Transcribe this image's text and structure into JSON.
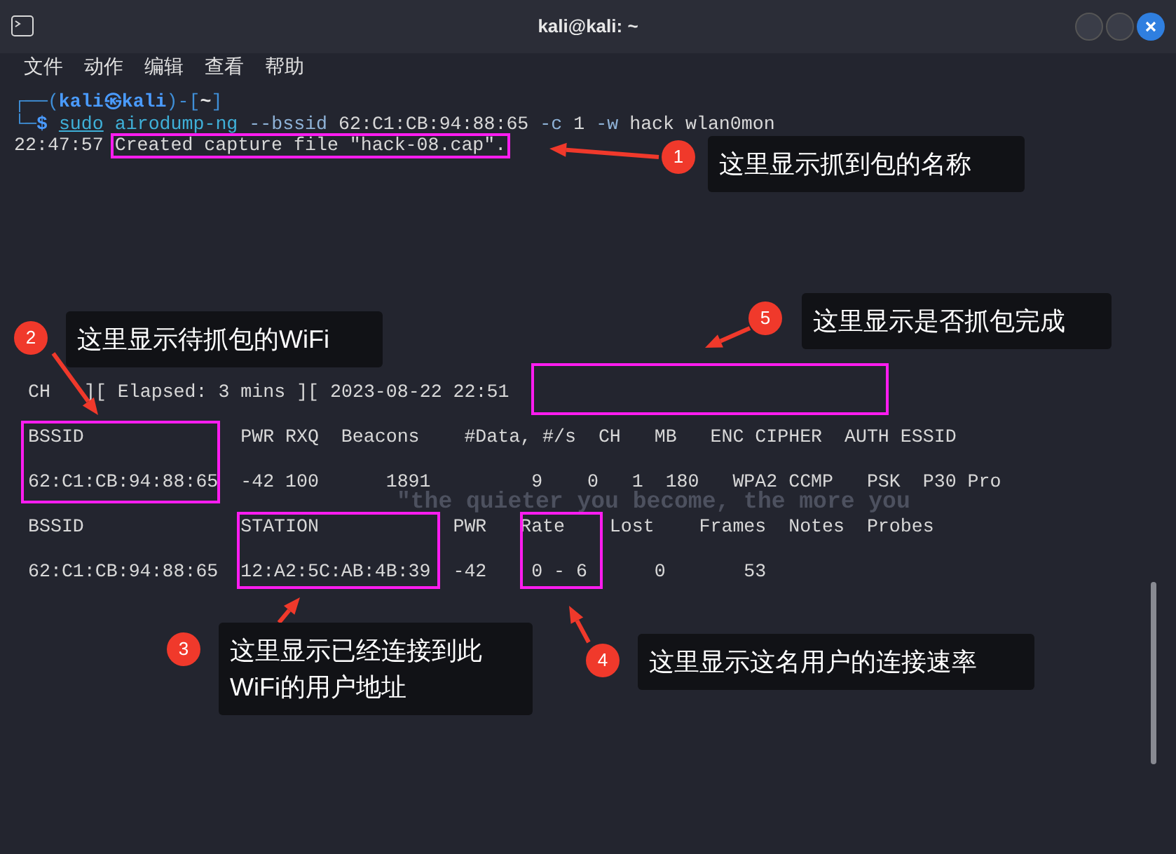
{
  "window": {
    "title": "kali@kali: ~"
  },
  "menu": [
    "文件",
    "动作",
    "编辑",
    "查看",
    "帮助"
  ],
  "terminal": {
    "prompt": [
      {
        "kind": "frame",
        "text": "┌──("
      },
      {
        "kind": "user",
        "text": "kali㉿kali"
      },
      {
        "kind": "frame",
        "text": ")-["
      },
      {
        "kind": "path",
        "text": "~"
      },
      {
        "kind": "frame",
        "text": "]"
      }
    ],
    "command": [
      {
        "kind": "frame",
        "text": "└─"
      },
      {
        "kind": "dollar",
        "text": "$"
      },
      {
        "kind": "sudo",
        "text": "sudo"
      },
      {
        "kind": "cmd",
        "text": "airodump-ng"
      },
      {
        "kind": "flag",
        "text": "--bssid"
      },
      {
        "kind": "arg",
        "text": "62:C1:CB:94:88:65"
      },
      {
        "kind": "flag",
        "text": "-c"
      },
      {
        "kind": "arg",
        "text": "1"
      },
      {
        "kind": "flag",
        "text": "-w"
      },
      {
        "kind": "arg",
        "text": "hack wlan0mon"
      }
    ],
    "output": [
      {
        "time": "22:47:57",
        "message": "Created capture file \"hack-08.cap\"."
      }
    ],
    "status": {
      "channel": "CH",
      "elapsed": "][ Elapsed: 3 mins ][ 2023-08-22 22:51"
    },
    "lines": [
      "BSSID              PWR RXQ  Beacons    #Data, #/s  CH   MB   ENC CIPHER  AUTH ESSID",
      "62:C1:CB:94:88:65  -42 100      1891         9    0   1  180   WPA2 CCMP   PSK  P30 Pro",
      "BSSID              STATION            PWR   Rate    Lost    Frames  Notes  Probes",
      "62:C1:CB:94:88:65  12:A2:5C:AB:4B:39  -42    0 - 6      0       53"
    ]
  },
  "wallpaper_text": "\"the quieter you become, the more you",
  "callouts": [
    {
      "number": "1",
      "text": "这里显示抓到包的名称"
    },
    {
      "number": "2",
      "text": "这里显示待抓包的WiFi"
    },
    {
      "number": "3",
      "text": "这里显示已经连接到此WiFi的用户地址"
    },
    {
      "number": "4",
      "text": "这里显示这名用户的连接速率"
    },
    {
      "number": "5",
      "text": "这里显示是否抓包完成"
    }
  ]
}
